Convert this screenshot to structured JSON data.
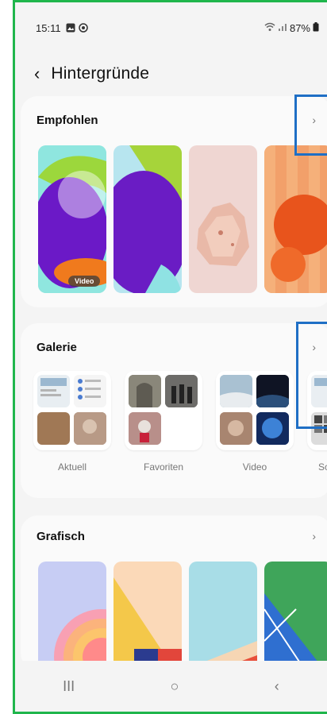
{
  "status_bar": {
    "time": "15:11",
    "battery": "87%",
    "icons": [
      "gallery-icon",
      "settings-icon",
      "wifi-icon",
      "signal-icon",
      "battery-icon"
    ]
  },
  "header": {
    "back_icon": "chevron-left-icon",
    "title": "Hintergründe"
  },
  "sections": {
    "recommended": {
      "title": "Empfohlen",
      "video_badge": "Video"
    },
    "gallery": {
      "title": "Galerie",
      "albums": [
        "Aktuell",
        "Favoriten",
        "Video",
        "Sc"
      ]
    },
    "graphic": {
      "title": "Grafisch"
    }
  },
  "navbar": {
    "recents_glyph": "III",
    "home_glyph": "○",
    "back_glyph": "‹"
  },
  "colors": {
    "accent_frame": "#1fb64c",
    "highlight_box": "#1f6fc5"
  }
}
